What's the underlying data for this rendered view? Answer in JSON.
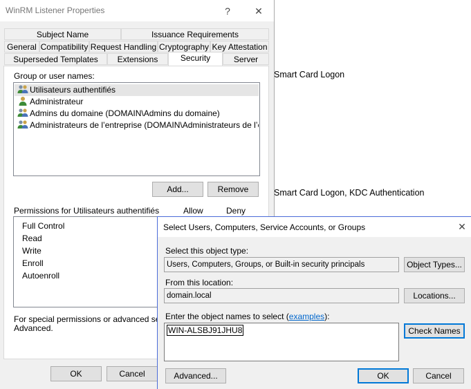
{
  "props": {
    "title": "WinRM Listener Properties",
    "help_glyph": "?",
    "close_glyph": "✕",
    "tabs_row1": [
      "Subject Name",
      "Issuance Requirements"
    ],
    "tabs_row2": [
      "General",
      "Compatibility",
      "Request Handling",
      "Cryptography",
      "Key Attestation"
    ],
    "tabs_row3": [
      "Superseded Templates",
      "Extensions",
      "Security",
      "Server"
    ],
    "active_tab": "Security",
    "group_label": "Group or user names:",
    "users": [
      {
        "name": "Utilisateurs authentifiés",
        "icon": "group-icon"
      },
      {
        "name": "Administrateur",
        "icon": "user-icon"
      },
      {
        "name": "Admins du domaine (DOMAIN\\Admins du domaine)",
        "icon": "group-icon"
      },
      {
        "name": "Administrateurs de l’entreprise (DOMAIN\\Administrateurs de l’entrep…",
        "icon": "group-icon"
      }
    ],
    "add_label": "Add...",
    "remove_label": "Remove",
    "perm_label": "Permissions for Utilisateurs authentifiés",
    "allow_header": "Allow",
    "deny_header": "Deny",
    "permissions": [
      "Full Control",
      "Read",
      "Write",
      "Enroll",
      "Autoenroll"
    ],
    "special_line1": "For special permissions or advanced settings",
    "special_line2": "Advanced.",
    "ok_label": "OK",
    "cancel_label": "Cancel"
  },
  "background": {
    "line1": "Smart Card Logon",
    "line2": "Smart Card Logon, KDC Authentication"
  },
  "picker": {
    "title": "Select Users, Computers, Service Accounts, or Groups",
    "close_glyph": "✕",
    "object_type_label": "Select this object type:",
    "object_type_value": "Users, Computers, Groups, or Built-in security principals",
    "object_types_button": "Object Types...",
    "location_label": "From this location:",
    "location_value": "domain.local",
    "locations_button": "Locations...",
    "enter_label_prefix": "Enter the object names to select (",
    "examples_link": "examples",
    "enter_label_suffix": "):",
    "names_value": "WIN-ALSBJ91JHU8",
    "check_names_button": "Check Names",
    "advanced_button": "Advanced...",
    "ok_button": "OK",
    "cancel_button": "Cancel"
  },
  "colors": {
    "accent": "#0078d7",
    "selection": "#e5e5e5",
    "link": "#0066cc"
  }
}
